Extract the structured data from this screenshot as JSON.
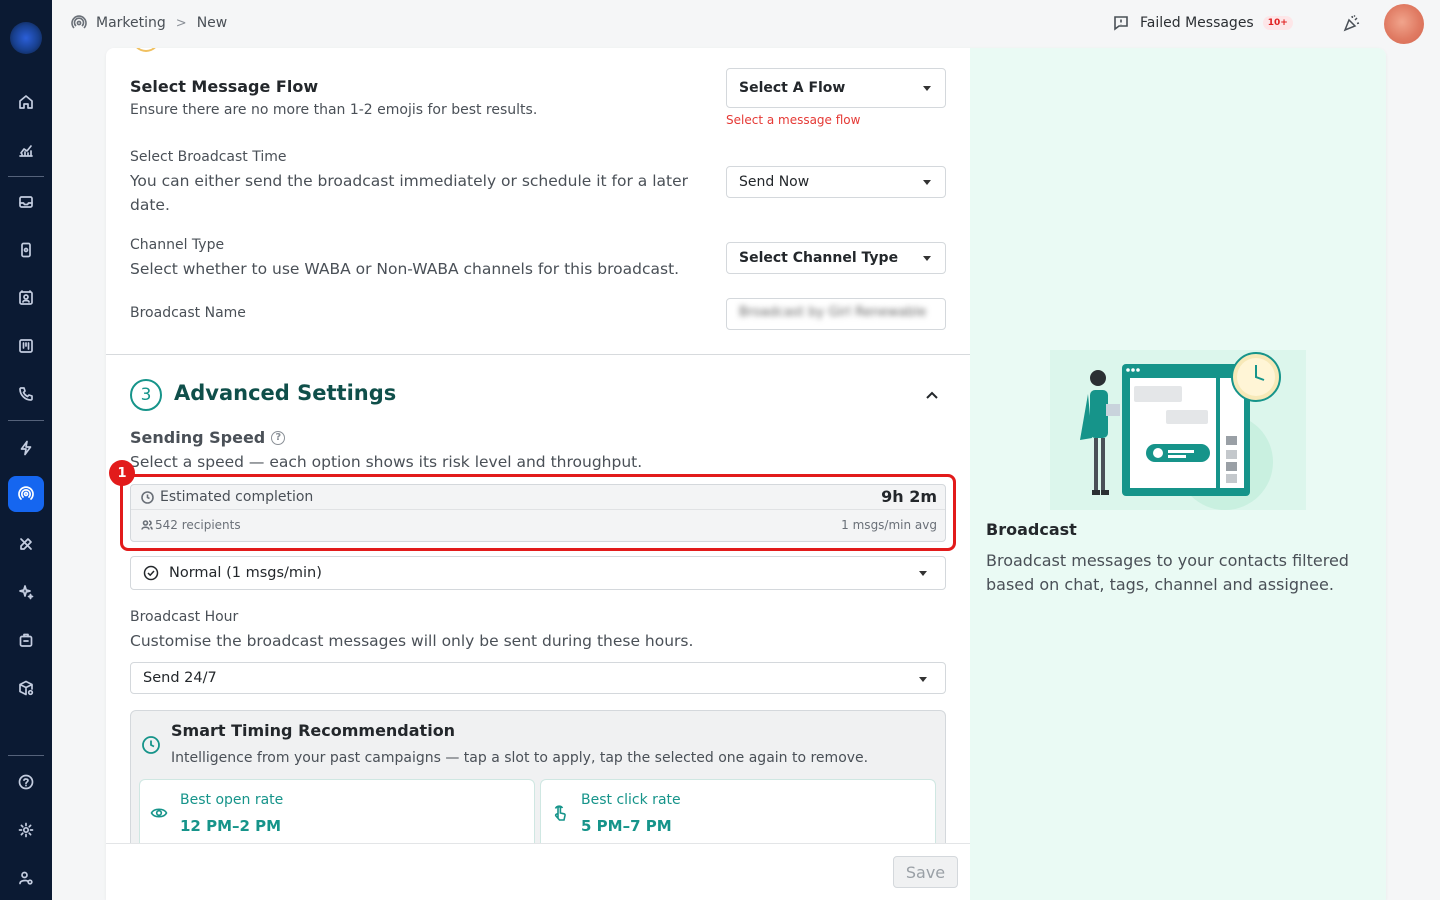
{
  "breadcrumb": {
    "section": "Marketing",
    "page": "New"
  },
  "header": {
    "failed_label": "Failed Messages",
    "failed_badge": "10+"
  },
  "message_flow": {
    "title": "Select Message Flow",
    "description": "Ensure there are no more than 1-2 emojis for best results.",
    "select_value": "Select A Flow",
    "error": "Select a message flow"
  },
  "broadcast_time": {
    "label": "Select Broadcast Time",
    "description": "You can either send the broadcast immediately or schedule it for a later date.",
    "select_value": "Send Now"
  },
  "channel_type": {
    "label": "Channel Type",
    "description": "Select whether to use WABA or Non-WABA channels for this broadcast.",
    "select_value": "Select Channel Type"
  },
  "broadcast_name": {
    "label": "Broadcast Name",
    "value": "Broadcast by Girl Renewable"
  },
  "advanced": {
    "step": "3",
    "title": "Advanced Settings"
  },
  "sending_speed": {
    "title": "Sending Speed",
    "description": "Select a speed — each option shows its risk level and throughput.",
    "estimate_label": "Estimated completion",
    "estimate_value": "9h 2m",
    "recipients": "542 recipients",
    "rate": "1 msgs/min avg",
    "selected": "Normal (1 msgs/min)"
  },
  "annotation": {
    "marker": "1"
  },
  "broadcast_hour": {
    "label": "Broadcast Hour",
    "description": "Customise the broadcast messages will only be sent during these hours.",
    "selected": "Send 24/7"
  },
  "smart_timing": {
    "title": "Smart Timing Recommendation",
    "description": "Intelligence from your past campaigns — tap a slot to apply, tap the selected one again to remove.",
    "slots": [
      {
        "label": "Best open rate",
        "time": "12 PM–2 PM",
        "icon": "eye-icon"
      },
      {
        "label": "Best click rate",
        "time": "5 PM–7 PM",
        "icon": "pointer-icon"
      }
    ]
  },
  "footer": {
    "save_label": "Save"
  },
  "info_panel": {
    "title": "Broadcast",
    "description": "Broadcast messages to your contacts filtered based on chat, tags, channel and assignee."
  },
  "colors": {
    "accent": "#16948a",
    "nav_active": "#1566f0",
    "sidebar": "#0b1a33",
    "highlight": "#e21b1b",
    "error": "#e53935"
  }
}
